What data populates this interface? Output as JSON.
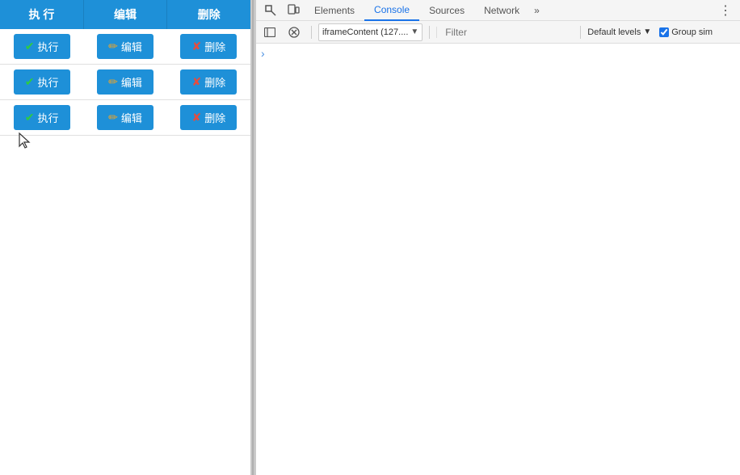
{
  "leftPanel": {
    "table": {
      "headers": [
        "执 行",
        "编辑",
        "删除"
      ],
      "rows": [
        {
          "execute": {
            "icon": "✔",
            "label": "执行"
          },
          "edit": {
            "icon": "✏",
            "label": "编辑"
          },
          "delete": {
            "icon": "✘",
            "label": "删除"
          }
        },
        {
          "execute": {
            "icon": "✔",
            "label": "执行"
          },
          "edit": {
            "icon": "✏",
            "label": "编辑"
          },
          "delete": {
            "icon": "✘",
            "label": "删除"
          }
        },
        {
          "execute": {
            "icon": "✔",
            "label": "执行"
          },
          "edit": {
            "icon": "✏",
            "label": "编辑"
          },
          "delete": {
            "icon": "✘",
            "label": "删除"
          }
        }
      ]
    }
  },
  "devtools": {
    "tabs": [
      {
        "label": "Elements",
        "active": false
      },
      {
        "label": "Console",
        "active": true
      },
      {
        "label": "Sources",
        "active": false
      },
      {
        "label": "Network",
        "active": false
      }
    ],
    "more_label": "»",
    "toolbar": {
      "context": "iframeContent (127....",
      "context_arrow": "▼",
      "filter_placeholder": "Filter",
      "levels_label": "Default levels",
      "levels_arrow": "▼",
      "group_sim_label": "Group sim"
    },
    "console": {
      "arrow": "›"
    }
  }
}
